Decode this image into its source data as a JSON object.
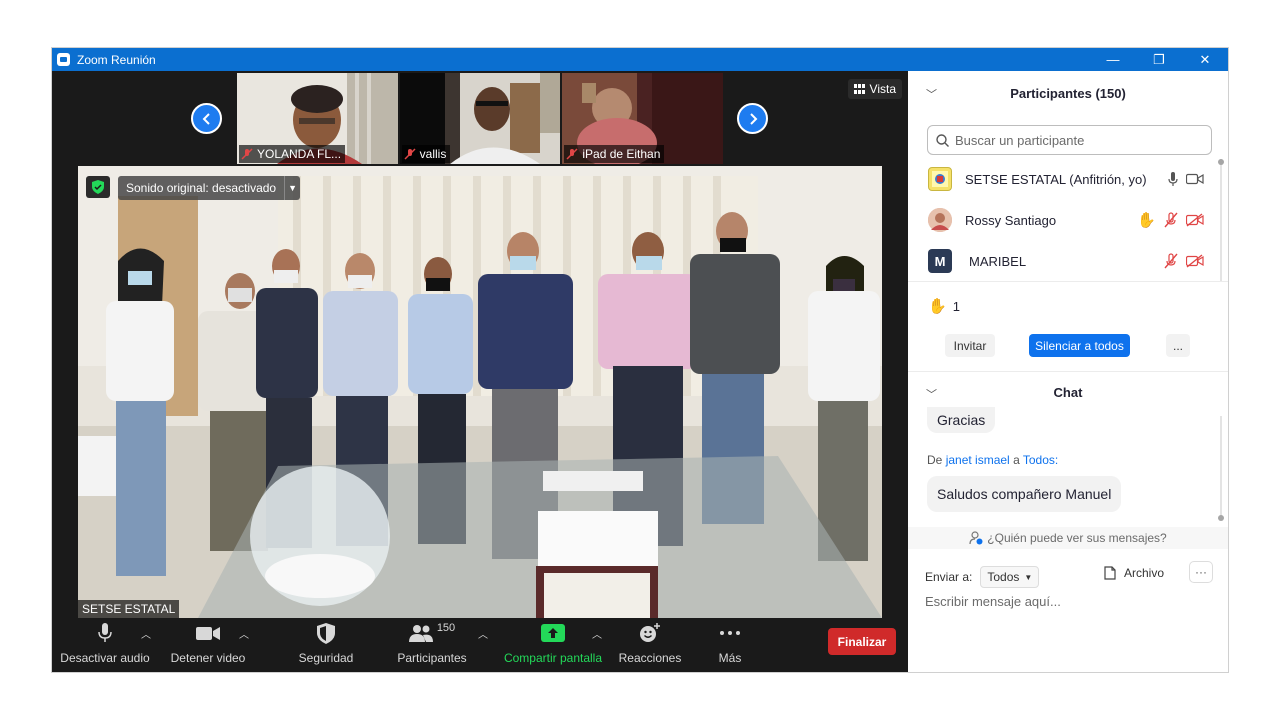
{
  "window": {
    "title": "Zoom Reunión",
    "minimize": "—",
    "restore": "❐",
    "close": "✕"
  },
  "thumbnails": [
    {
      "name": "YOLANDA FL..."
    },
    {
      "name": "vallis"
    },
    {
      "name": "iPad de Eithan"
    }
  ],
  "view_button": "Vista",
  "main_video": {
    "sound_label": "Sonido original: desactivado",
    "name": "SETSE ESTATAL"
  },
  "toolbar": {
    "audio": "Desactivar audio",
    "video": "Detener video",
    "security": "Seguridad",
    "participants": "Participantes",
    "participant_count": "150",
    "share": "Compartir pantalla",
    "reactions": "Reacciones",
    "more": "Más",
    "end": "Finalizar"
  },
  "participants_panel": {
    "title": "Participantes (150)",
    "search_placeholder": "Buscar un participante",
    "items": [
      {
        "name": "SETSE ESTATAL (Anfitrión, yo)"
      },
      {
        "name": "Rossy Santiago"
      },
      {
        "name": "MARIBEL",
        "initial": "M"
      }
    ],
    "hands_raised": "1",
    "invite": "Invitar",
    "mute_all": "Silenciar a todos",
    "more": "..."
  },
  "chat": {
    "title": "Chat",
    "prev_message": "Gracias",
    "from_prefix": "De",
    "from_user": "janet ismael",
    "to_word": "a",
    "to_target": "Todos:",
    "message": "Saludos compañero Manuel",
    "who_can_see": "¿Quién puede ver sus mensajes?",
    "send_to_label": "Enviar a:",
    "send_to_value": "Todos",
    "file": "Archivo",
    "more": "···",
    "input_placeholder": "Escribir mensaje aquí..."
  },
  "colors": {
    "titlebar": "#0b6fd0",
    "accent": "#0e72ed",
    "end": "#d02a2a",
    "share": "#23d959"
  }
}
